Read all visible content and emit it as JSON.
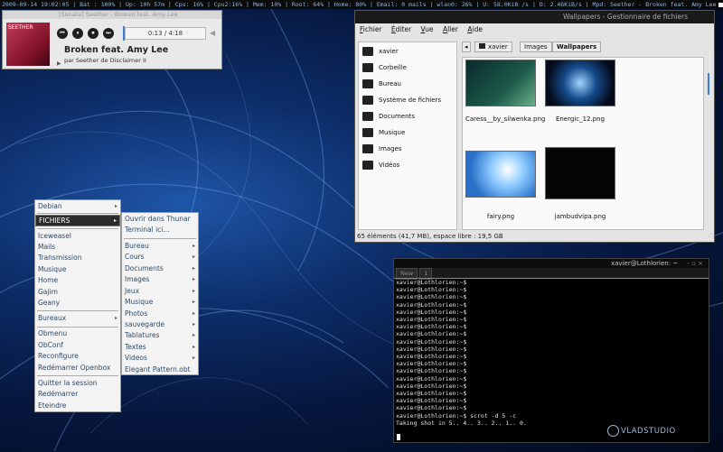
{
  "statusbar": {
    "text": "2009-09-14 19:02:05 | Bat : 100% | Up: 10h 57m | Cpu: 16% | Cpu2:16% | Mem: 10% | Root: 64% | Home: 80% | Email: 0 mails | wlan0: 26% | U: 58.0KiB /s | D: 2.46KiB/s | Mpd: Seether - Broken feat. Amy Lee",
    "progress": 0.25
  },
  "player": {
    "title": "[Sonata] Seether - Broken feat. Amy Lee",
    "cover_text": "SEETHER",
    "time": "0:13 / 4:18",
    "song": "Broken feat. Amy Lee",
    "artist": "par Seether de Disclaimer II",
    "controls": {
      "prev": "⏮",
      "pause": "⏸",
      "stop": "⏹",
      "next": "⏭"
    }
  },
  "filemanager": {
    "title": "Wallpapers - Gestionnaire de fichiers",
    "menu": [
      {
        "u": "F",
        "rest": "ichier"
      },
      {
        "u": "É",
        "rest": "diter"
      },
      {
        "u": "V",
        "rest": "ue"
      },
      {
        "u": "A",
        "rest": "ller"
      },
      {
        "u": "A",
        "rest": "ide"
      }
    ],
    "sidebar": [
      "xavier",
      "Corbeille",
      "Bureau",
      "Système de fichiers",
      "Documents",
      "Musique",
      "Images",
      "Vidéos"
    ],
    "path": [
      "xavier",
      "Images",
      "Wallpapers"
    ],
    "files": [
      "Caress__by_silwenka.png",
      "Energic_12.png",
      "fairy.png",
      "jambudvipa.png"
    ],
    "status": "65 éléments (41,7 MB), espace libre : 19,5 GB"
  },
  "menu1": {
    "top": "Debian",
    "selected": "FICHIERS",
    "items": [
      "Iceweasel",
      "Mails",
      "Transmission",
      "Musique",
      "Home",
      "Gajim",
      "Geany"
    ],
    "bureaux": "Bureaux",
    "items2": [
      "Obmenu",
      "ObConf",
      "Reconfigure",
      "Redémarrer Openbox"
    ],
    "items3": [
      "Quitter la session",
      "Redémarrer",
      "Eteindre"
    ]
  },
  "menu2": {
    "items": [
      "Ouvrir dans Thunar",
      "Terminal ici..."
    ],
    "folders": [
      "Bureau",
      "Cours",
      "Documents",
      "Images",
      "Jeux",
      "Musique",
      "Photos",
      "sauvegarde",
      "Tablatures",
      "Textes",
      "Videos"
    ],
    "last": "Elegant Pattern.obt"
  },
  "terminal": {
    "title": "xavier@Lothlorien: ~",
    "tabs": [
      "New",
      "1"
    ],
    "content": "xavier@Lothlorien:~$\nxavier@Lothlorien:~$\nxavier@Lothlorien:~$\nxavier@Lothlorien:~$\nxavier@Lothlorien:~$\nxavier@Lothlorien:~$\nxavier@Lothlorien:~$\nxavier@Lothlorien:~$\nxavier@Lothlorien:~$\nxavier@Lothlorien:~$\nxavier@Lothlorien:~$\nxavier@Lothlorien:~$\nxavier@Lothlorien:~$\nxavier@Lothlorien:~$\nxavier@Lothlorien:~$\nxavier@Lothlorien:~$\nxavier@Lothlorien:~$\nxavier@Lothlorien:~$\nxavier@Lothlorien:~$ scrot -d 5 -c\nTaking shot in 5.. 4.. 3.. 2.. 1.. 0."
  },
  "logo": "VLADSTUDIO"
}
